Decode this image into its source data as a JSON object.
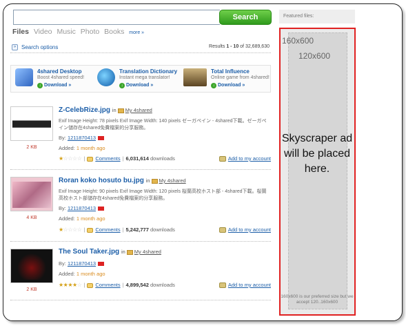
{
  "search": {
    "value": "",
    "button_label": "Search"
  },
  "type_tabs": [
    {
      "label": "Files",
      "active": true
    },
    {
      "label": "Video",
      "active": false
    },
    {
      "label": "Music",
      "active": false
    },
    {
      "label": "Photo",
      "active": false
    },
    {
      "label": "Books",
      "active": false
    }
  ],
  "more_link": "more »",
  "search_options_label": "Search options",
  "results_summary": {
    "prefix": "Results ",
    "range": "1 - 10",
    "of": " of ",
    "total": "32,689,630"
  },
  "promos": [
    {
      "title": "4shared Desktop",
      "subtitle": "Boost 4shared speed!",
      "download": "Download »",
      "icon": "desktop-app-icon",
      "color": "#3a7bd5"
    },
    {
      "title": "Translation Dictionary",
      "subtitle": "Instant mega translator!",
      "download": "Download »",
      "icon": "dictionary-app-icon",
      "color": "#1f6fb2"
    },
    {
      "title": "Total Influence",
      "subtitle": "Online game from 4shared!",
      "download": "Download »",
      "icon": "game-icon",
      "color": "#8a6a3a"
    }
  ],
  "results": [
    {
      "title": "Z-CelebRize.jpg",
      "in_label": "in",
      "folder": "My 4shared",
      "description": "Exif Image Height: 78 pixels Exif Image Width: 140 pixels ゼーガペイン - 4shared下載。ゼーガペイン儲存在4shared免費檔案的分享服務。",
      "size": "2 KB",
      "by_label": "By:",
      "user": "1211870413",
      "added_label": "Added:",
      "added_ago": "1 month ago",
      "rating": 1,
      "comments_label": "Comments",
      "downloads": "6,031,614",
      "downloads_label": "downloads",
      "add_label": "Add to my account",
      "thumb_color": "#ffffff"
    },
    {
      "title": "Roran koko hosuto bu.jpg",
      "in_label": "in",
      "folder": "My 4shared",
      "description": "Exif Image Height: 90 pixels Exif Image Width: 120 pixels 桜蘭高校ホスト部 - 4shared下載。桜蘭高校ホスト部儲存在4shared免費檔案的分享服務。",
      "size": "4 KB",
      "by_label": "By:",
      "user": "1211870413",
      "added_label": "Added:",
      "added_ago": "1 month ago",
      "rating": 1,
      "comments_label": "Comments",
      "downloads": "5,242,777",
      "downloads_label": "downloads",
      "add_label": "Add to my account",
      "thumb_color": "#e7b7c4"
    },
    {
      "title": "The Soul Taker.jpg",
      "in_label": "in",
      "folder": "My 4shared",
      "description": "",
      "size": "2 KB",
      "by_label": "By:",
      "user": "1211870413",
      "added_label": "Added:",
      "added_ago": "1 month ago",
      "rating": 4,
      "comments_label": "Comments",
      "downloads": "4,899,542",
      "downloads_label": "downloads",
      "add_label": "Add to my account",
      "thumb_color": "#1a1a1a"
    }
  ],
  "sidebar": {
    "featured_label": "Featured files:",
    "ad_size_a": "160x600",
    "ad_size_b": "120x600",
    "ad_text": "Skyscraper ad will be placed here.",
    "ad_note": "160x600 is our preferred size but we accept 120..160x600",
    "highlight_color": "#e02020"
  }
}
